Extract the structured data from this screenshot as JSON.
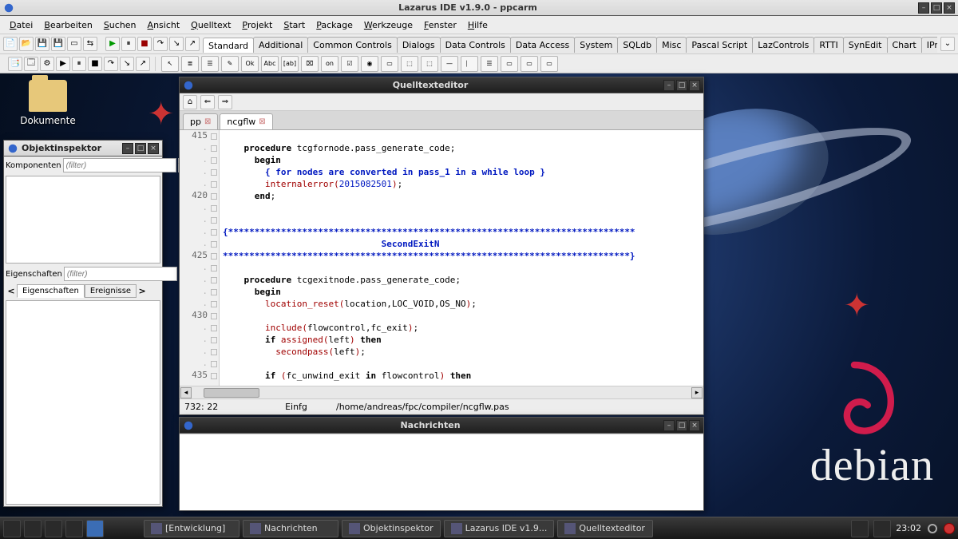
{
  "ide": {
    "title": "Lazarus IDE v1.9.0 - ppcarm",
    "menu": [
      "Datei",
      "Bearbeiten",
      "Suchen",
      "Ansicht",
      "Quelltext",
      "Projekt",
      "Start",
      "Package",
      "Werkzeuge",
      "Fenster",
      "Hilfe"
    ],
    "palette_tabs": [
      "Standard",
      "Additional",
      "Common Controls",
      "Dialogs",
      "Data Controls",
      "Data Access",
      "System",
      "SQLdb",
      "Misc",
      "Pascal Script",
      "LazControls",
      "RTTI",
      "SynEdit",
      "Chart",
      "IPro"
    ],
    "active_palette": "Standard",
    "components": [
      "↖",
      "≣",
      "☰",
      "✎",
      "Ok",
      "Abc",
      "[ab]",
      "⌧",
      "on",
      "☑",
      "◉",
      "▭",
      "⬚",
      "⬚",
      "—",
      "⎸",
      "☰",
      "▭",
      "▭",
      "▭"
    ]
  },
  "desktop": {
    "folder_label": "Dokumente",
    "brand": "debian"
  },
  "object_inspector": {
    "title": "Objektinspektor",
    "components_label": "Komponenten",
    "filter_placeholder": "(filter)",
    "properties_label": "Eigenschaften",
    "tabs": [
      "Eigenschaften",
      "Ereignisse"
    ]
  },
  "source_editor": {
    "title": "Quelltexteditor",
    "tabs": [
      {
        "label": "pp",
        "active": false
      },
      {
        "label": "ncgflw",
        "active": true
      }
    ],
    "first_line": 415,
    "code_lines": [
      {
        "n": "415",
        "t": ""
      },
      {
        "n": "",
        "t": "    <kw>procedure</kw> tcgfornode.pass_generate_code;"
      },
      {
        "n": "",
        "t": "      <kw>begin</kw>"
      },
      {
        "n": "",
        "t": "        <cm>{ for nodes are converted in pass_1 in a while loop }</cm>"
      },
      {
        "n": "",
        "t": "        <fn>internalerror</fn><sym>(</sym><num>2015082501</num><sym>)</sym>;"
      },
      {
        "n": "420",
        "t": "      <kw>end</kw>;"
      },
      {
        "n": "",
        "t": ""
      },
      {
        "n": "",
        "t": ""
      },
      {
        "n": "",
        "t": "<cm2>{*****************************************************************************</cm2>"
      },
      {
        "n": "",
        "t": "<cm2>                              SecondExitN</cm2>"
      },
      {
        "n": "425",
        "t": "<cm2>*****************************************************************************}</cm2>"
      },
      {
        "n": "",
        "t": ""
      },
      {
        "n": "",
        "t": "    <kw>procedure</kw> tcgexitnode.pass_generate_code;"
      },
      {
        "n": "",
        "t": "      <kw>begin</kw>"
      },
      {
        "n": "",
        "t": "        <fn>location_reset</fn><sym>(</sym>location,LOC_VOID,OS_NO<sym>)</sym>;"
      },
      {
        "n": "430",
        "t": ""
      },
      {
        "n": "",
        "t": "        <fn>include</fn><sym>(</sym>flowcontrol,fc_exit<sym>)</sym>;"
      },
      {
        "n": "",
        "t": "        <kw>if</kw> <fn>assigned</fn><sym>(</sym>left<sym>)</sym> <kw>then</kw>"
      },
      {
        "n": "",
        "t": "          <fn>secondpass</fn><sym>(</sym>left<sym>)</sym>;"
      },
      {
        "n": "",
        "t": ""
      },
      {
        "n": "435",
        "t": "        <kw>if</kw> <sym>(</sym>fc_unwind_exit <kw>in</kw> flowcontrol<sym>)</sym> <kw>then</kw>"
      }
    ],
    "status": {
      "pos": "732: 22",
      "mode": "Einfg",
      "path": "/home/andreas/fpc/compiler/ncgflw.pas"
    }
  },
  "messages": {
    "title": "Nachrichten"
  },
  "taskbar": {
    "buttons": [
      "[Entwicklung]",
      "Nachrichten",
      "Objektinspektor",
      "Lazarus IDE v1.9...",
      "Quelltexteditor"
    ],
    "clock": "23:02"
  }
}
